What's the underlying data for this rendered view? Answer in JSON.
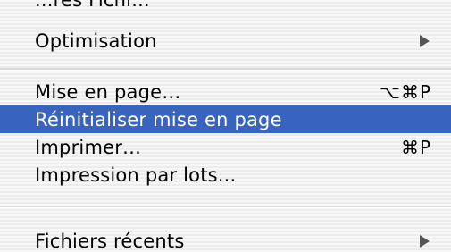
{
  "menu": {
    "partial_item": {
      "label": "...res Fichi..."
    },
    "items": [
      {
        "label": "Optimisation",
        "shortcut": "",
        "submenu": true
      },
      {
        "label": "Mise en page…",
        "shortcut": "⌥⌘P",
        "submenu": false
      },
      {
        "label": "Réinitialiser mise en page",
        "shortcut": "",
        "submenu": false,
        "selected": true
      },
      {
        "label": "Imprimer…",
        "shortcut": "⌘P",
        "submenu": false
      },
      {
        "label": "Impression par lots...",
        "shortcut": "",
        "submenu": false
      },
      {
        "label": "Fichiers récents",
        "shortcut": "",
        "submenu": true
      }
    ],
    "colors": {
      "highlight": "#3864c0",
      "highlight_text": "#ffffff",
      "text": "#000000",
      "arrow": "#555555"
    }
  }
}
